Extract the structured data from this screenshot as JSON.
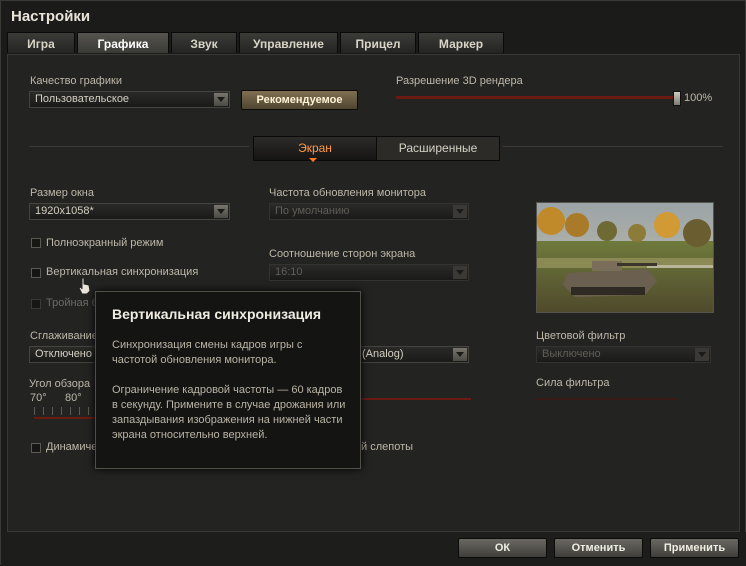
{
  "window": {
    "title": "Настройки"
  },
  "tabs": [
    {
      "label": "Игра",
      "active": false
    },
    {
      "label": "Графика",
      "active": true
    },
    {
      "label": "Звук",
      "active": false
    },
    {
      "label": "Управление",
      "active": false
    },
    {
      "label": "Прицел",
      "active": false
    },
    {
      "label": "Маркер",
      "active": false
    }
  ],
  "quality": {
    "label": "Качество графики",
    "value": "Пользовательское",
    "recommended_button": "Рекомендуемое"
  },
  "render_resolution": {
    "label": "Разрешение 3D рендера",
    "value_text": "100%",
    "value": 100
  },
  "subtabs": [
    {
      "label": "Экран",
      "active": true
    },
    {
      "label": "Расширенные",
      "active": false
    }
  ],
  "window_size": {
    "label": "Размер окна",
    "value": "1920x1058*"
  },
  "fullscreen": {
    "label": "Полноэкранный режим",
    "checked": false
  },
  "vsync": {
    "label": "Вертикальная синхронизация",
    "checked": false
  },
  "triple_buffer": {
    "label": "Тройная б",
    "checked": false,
    "disabled": true
  },
  "refresh_rate": {
    "label": "Частота обновления монитора",
    "value": "По умолчанию",
    "disabled": true
  },
  "aspect_ratio": {
    "label": "Соотношение сторон экрана",
    "value": "16:10",
    "disabled": true
  },
  "smoothing": {
    "label": "Сглаживание",
    "value": "Отключено"
  },
  "monitor_select": {
    "value_visible": "(Analog)"
  },
  "fov": {
    "label": "Угол обзора",
    "min_label": "70°",
    "max_label": "80°"
  },
  "dynamic": {
    "label": "Динамиче",
    "checked": false
  },
  "colorblind": {
    "label_visible": "й слепоты"
  },
  "color_filter": {
    "label": "Цветовой фильтр",
    "value": "Выключено",
    "disabled": true
  },
  "filter_strength": {
    "label": "Сила фильтра"
  },
  "tooltip": {
    "title": "Вертикальная синхронизация",
    "text1": "Синхронизация смены кадров игры с частотой обновления монитора.",
    "text2": "Ограничение кадровой частоты — 60 кадров в секунду. Примените в случае дрожания или запаздывания изображения на нижней части экрана относительно верхней."
  },
  "footer": {
    "ok": "ОК",
    "cancel": "Отменить",
    "apply": "Применить"
  }
}
